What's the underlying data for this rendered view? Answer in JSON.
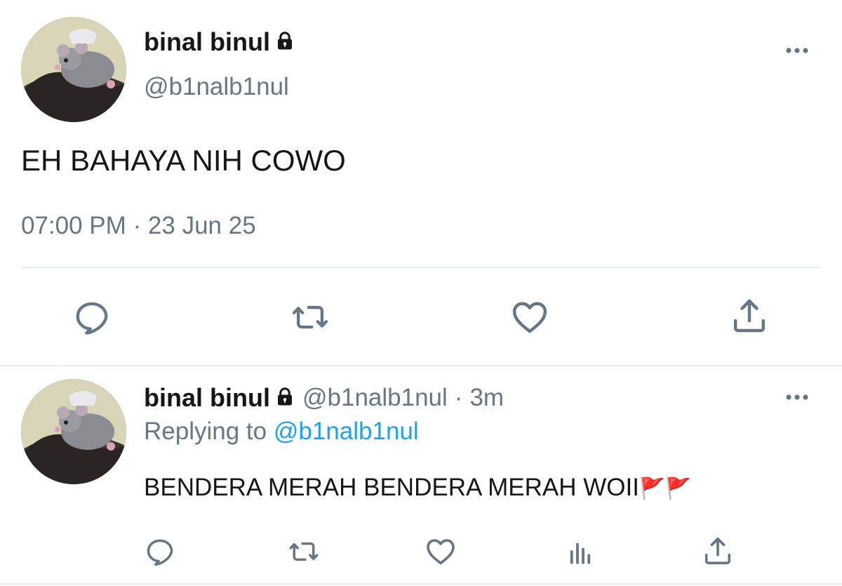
{
  "main_tweet": {
    "display_name": "binal binul",
    "handle": "@b1nalb1nul",
    "text": "EH BAHAYA NIH COWO",
    "timestamp": "07:00 PM · 23 Jun 25",
    "protected_icon": "lock-icon",
    "actions": [
      "reply-icon",
      "retweet-icon",
      "like-icon",
      "share-icon"
    ]
  },
  "reply_tweet": {
    "display_name": "binal binul",
    "handle": "@b1nalb1nul",
    "separator": "·",
    "time_ago": "3m",
    "replying_prefix": "Replying to",
    "replying_handle": "@b1nalb1nul",
    "text": "BENDERA MERAH BENDERA MERAH WOII",
    "emoji": "🚩🚩",
    "protected_icon": "lock-icon",
    "actions": [
      "reply-icon",
      "retweet-icon",
      "like-icon",
      "analytics-icon",
      "share-icon"
    ]
  },
  "colors": {
    "text": "#14171a",
    "muted": "#657786",
    "link": "#1da1f2",
    "divider": "#e6ecf0"
  }
}
